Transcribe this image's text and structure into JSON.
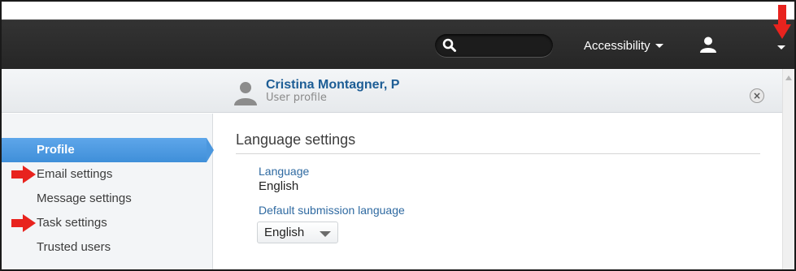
{
  "topbar": {
    "accessibility_label": "Accessibility"
  },
  "icons": {
    "search": "search-icon",
    "user": "user-icon",
    "menu_caret": "caret-down-icon",
    "close": "close-icon"
  },
  "header": {
    "user_name": "Cristina Montagner, P",
    "user_subtitle": "User profile",
    "close_symbol": "×"
  },
  "sidebar": {
    "items": [
      {
        "label": "Profile",
        "active": true
      },
      {
        "label": "Email settings",
        "active": false
      },
      {
        "label": "Message settings",
        "active": false
      },
      {
        "label": "Task settings",
        "active": false
      },
      {
        "label": "Trusted users",
        "active": false
      }
    ]
  },
  "content": {
    "title": "Language settings",
    "language_label": "Language",
    "language_value": "English",
    "default_submission_label": "Default submission language",
    "default_submission_value": "English"
  },
  "colors": {
    "topbar": "#2b2b2b",
    "accent": "#4b97de",
    "link": "#1d5d95",
    "annotation": "#e8231e"
  }
}
